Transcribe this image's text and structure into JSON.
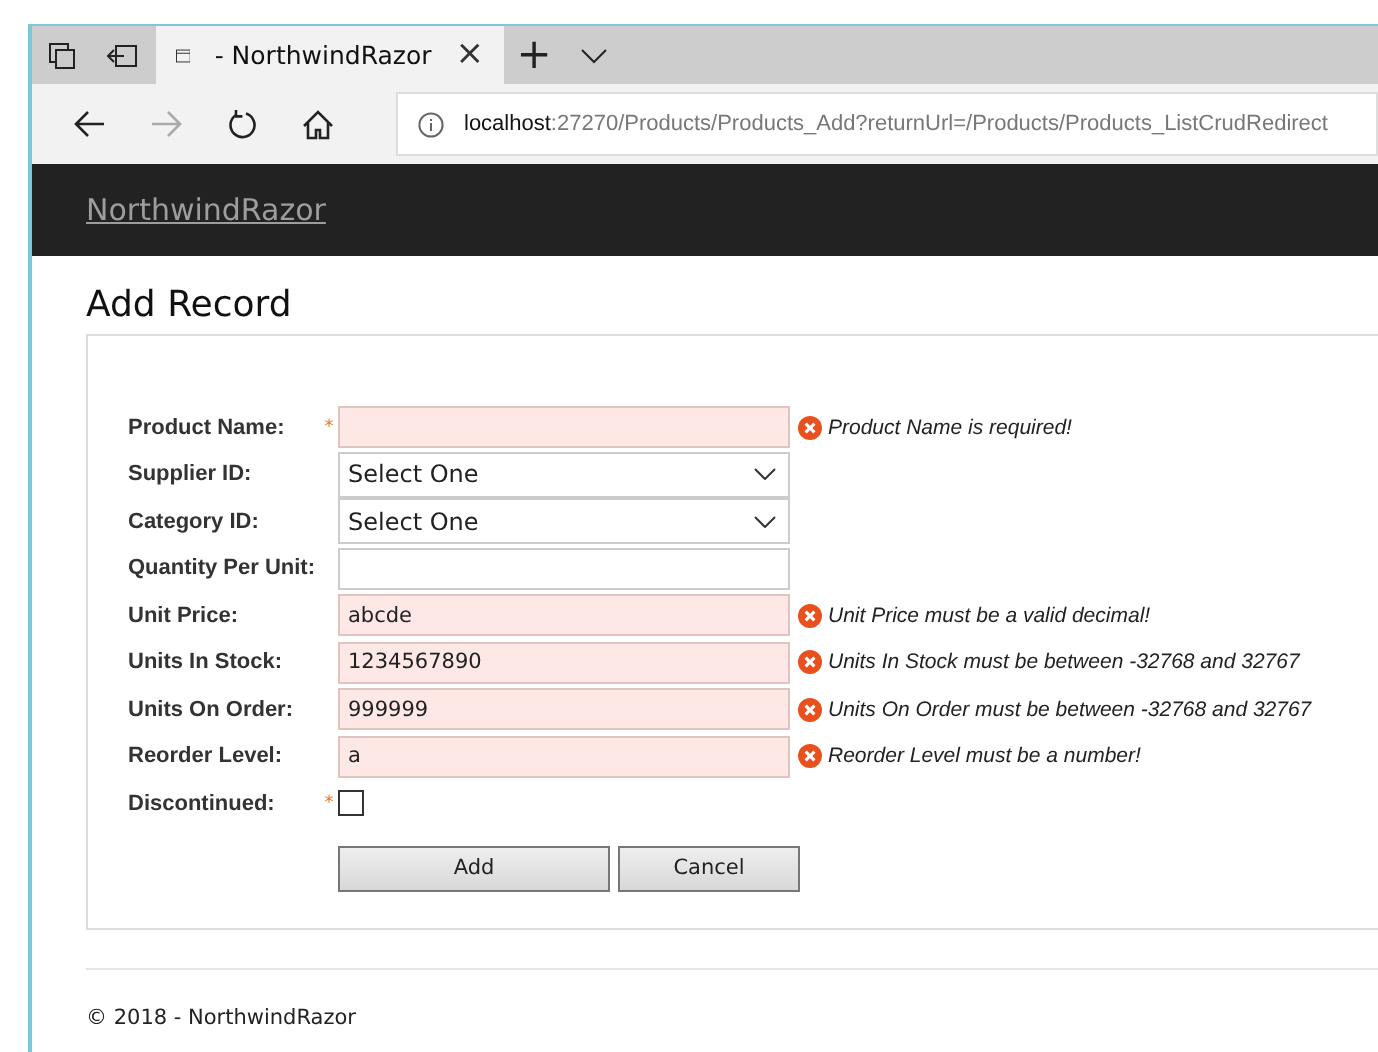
{
  "browser": {
    "tab_title": "- NorthwindRazor",
    "tab_close": "×",
    "new_tab": "+",
    "url_host": "localhost",
    "url_rest": ":27270/Products/Products_Add?returnUrl=/Products/Products_ListCrudRedirect"
  },
  "navbar": {
    "brand": "NorthwindRazor"
  },
  "page_title": "Add Record",
  "fields": [
    {
      "kind": "text",
      "label": "Product Name:",
      "required_mark": "*",
      "invalid": true,
      "error": "Product Name is required!"
    },
    {
      "kind": "select",
      "label": "Supplier ID:",
      "value": "Select One"
    },
    {
      "kind": "select",
      "label": "Category ID:",
      "value": "Select One"
    },
    {
      "kind": "text",
      "label": "Quantity Per Unit:",
      "invalid": false
    },
    {
      "kind": "text",
      "label": "Unit Price:",
      "value": "abcde",
      "invalid": true,
      "error": "Unit Price must be a valid decimal!"
    },
    {
      "kind": "text",
      "label": "Units In Stock:",
      "value": "1234567890",
      "invalid": true,
      "error": "Units In Stock must be between -32768 and 32767"
    },
    {
      "kind": "text",
      "label": "Units On Order:",
      "value": "999999",
      "invalid": true,
      "error": "Units On Order must be between -32768 and 32767"
    },
    {
      "kind": "text",
      "label": "Reorder Level:",
      "value": "a",
      "invalid": true,
      "error": "Reorder Level must be a number!"
    },
    {
      "kind": "checkbox",
      "label": "Discontinued:",
      "required_mark": "*",
      "checked": false
    }
  ],
  "buttons": [
    "Add",
    "Cancel"
  ],
  "footer": "© 2018 - NorthwindRazor"
}
